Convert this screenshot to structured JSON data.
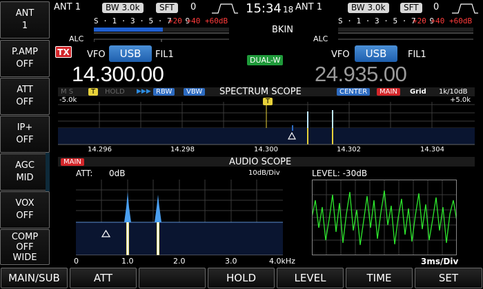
{
  "left_panel": {
    "items": [
      {
        "label": "ANT",
        "value": "1"
      },
      {
        "label": "P.AMP",
        "value": "OFF"
      },
      {
        "label": "ATT",
        "value": "OFF"
      },
      {
        "label": "IP+",
        "value": "OFF"
      },
      {
        "label": "AGC",
        "value": "MID"
      },
      {
        "label": "VOX",
        "value": "OFF"
      },
      {
        "label": "COMP",
        "value": "OFF",
        "value2": "WIDE"
      }
    ]
  },
  "main_vfo": {
    "ant": "ANT 1",
    "bw": "BW 3.0k",
    "sft_label": "SFT",
    "sft_value": "0",
    "scale_s": "S · 1 · 3 · 5 · 7 · 9",
    "scale_db": "+20 +40 +60dB",
    "alc": "ALC",
    "tx": "TX",
    "vfo": "VFO",
    "mode": "USB",
    "fil": "FIL1",
    "frequency": "14.300.00"
  },
  "sub_vfo": {
    "ant": "ANT 1",
    "bw": "BW 3.0k",
    "sft_label": "SFT",
    "sft_value": "0",
    "scale_s": "S · 1 · 3 · 5 · 7 · 9",
    "scale_db": "+20 +40 +60dB",
    "alc": "ALC",
    "vfo": "VFO",
    "mode": "USB",
    "fil": "FIL1",
    "frequency": "24.935.00"
  },
  "center": {
    "time": "15:34",
    "seconds": "18",
    "bkin": "BKIN",
    "dual_watch": "DUAL-W"
  },
  "spectrum_scope": {
    "title": "SPECTRUM SCOPE",
    "left_tags": "M  S",
    "t_marker": "T",
    "hold": "HOLD",
    "arrows": "▶▶▶",
    "rbw": "RBW",
    "vbw": "VBW",
    "center": "CENTER",
    "main": "MAIN",
    "grid": "Grid",
    "scale": "1k/10dB",
    "span_left": "-5.0k",
    "span_right": "+5.0k",
    "freq_labels": [
      "14.296",
      "14.298",
      "14.300",
      "14.302",
      "14.304"
    ]
  },
  "audio_scope": {
    "main_tag": "MAIN",
    "title": "AUDIO SCOPE",
    "att": "ATT:",
    "att_value": "0dB",
    "scale": "10dB/Div",
    "level": "LEVEL: -30dB",
    "x_labels": [
      "0",
      "1.0",
      "2.0",
      "3.0",
      "4.0kHz"
    ],
    "time_scale": "3ms/Div"
  },
  "bottom_bar": {
    "buttons": [
      "MAIN/SUB",
      "ATT",
      "",
      "HOLD",
      "LEVEL",
      "TIME",
      "SET"
    ]
  },
  "colors": {
    "accent_blue": "#2d6bc1",
    "tx_red": "#d3262a",
    "dual_green": "#1f9a3a",
    "meter_red": "#ff3b3b",
    "marker_yellow": "#e8d23a",
    "osc_green": "#2ee82e"
  }
}
